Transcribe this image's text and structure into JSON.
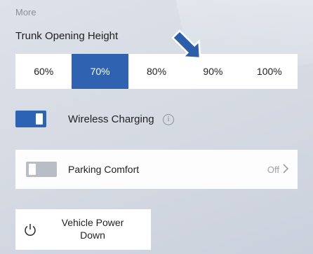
{
  "section_label": "More",
  "trunk": {
    "title": "Trunk Opening Height",
    "options": [
      "60%",
      "70%",
      "80%",
      "90%",
      "100%"
    ],
    "selected": "70%"
  },
  "wireless_charging": {
    "label": "Wireless Charging",
    "enabled": true,
    "info_icon": "i"
  },
  "parking_comfort": {
    "label": "Parking Comfort",
    "status": "Off",
    "enabled": false
  },
  "vehicle_power": {
    "label": "Vehicle Power Down"
  },
  "colors": {
    "accent": "#2f63b2",
    "toggle_off": "#b9bec6",
    "arrow": "#2c5fab"
  },
  "icons": {
    "info": "info-icon",
    "chevron": "chevron-right-icon",
    "power": "power-icon",
    "pointer": "arrow-pointer-icon"
  }
}
